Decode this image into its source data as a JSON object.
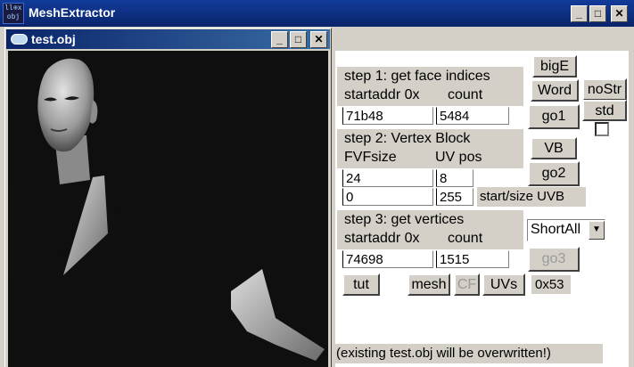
{
  "app": {
    "title": "MeshExtractor",
    "icon_lines": [
      "ll⊕x",
      "obj"
    ]
  },
  "child": {
    "title": "test.obj"
  },
  "step1": {
    "heading": "step 1: get face indices",
    "startaddr_label": "startaddr 0x",
    "count_label": "count",
    "startaddr_value": "71b48",
    "count_value": "5484"
  },
  "step2": {
    "heading": "step 2: Vertex Block",
    "fvfsize_label": "FVFsize",
    "uvpos_label": "UV pos",
    "fvfsize_value": "24",
    "uvpos_value": "8",
    "uvb_start_value": "0",
    "uvb_size_value": "255",
    "uvb_label": "start/size UVB"
  },
  "step3": {
    "heading": "step 3: get vertices",
    "startaddr_label": "startaddr 0x",
    "count_label": "count",
    "startaddr_value": "74698",
    "count_value": "1515",
    "format_select": "ShortAll"
  },
  "buttons": {
    "bigE": "bigE",
    "word": "Word",
    "nostr": "noStr",
    "std": "std",
    "go1": "go1",
    "vb": "VB",
    "go2": "go2",
    "go3": "go3",
    "tut": "tut",
    "mesh": "mesh",
    "cf": "CF",
    "uvs": "UVs"
  },
  "hex_label": "0x53",
  "footer_note": "(existing test.obj will be overwritten!)",
  "colors": {
    "title_bar": "#0a246a",
    "face": "#d4d0c8",
    "viewport_bg": "#0f0f0f"
  },
  "caption_buttons": {
    "minimize": "_",
    "maximize": "□",
    "close": "✕"
  }
}
